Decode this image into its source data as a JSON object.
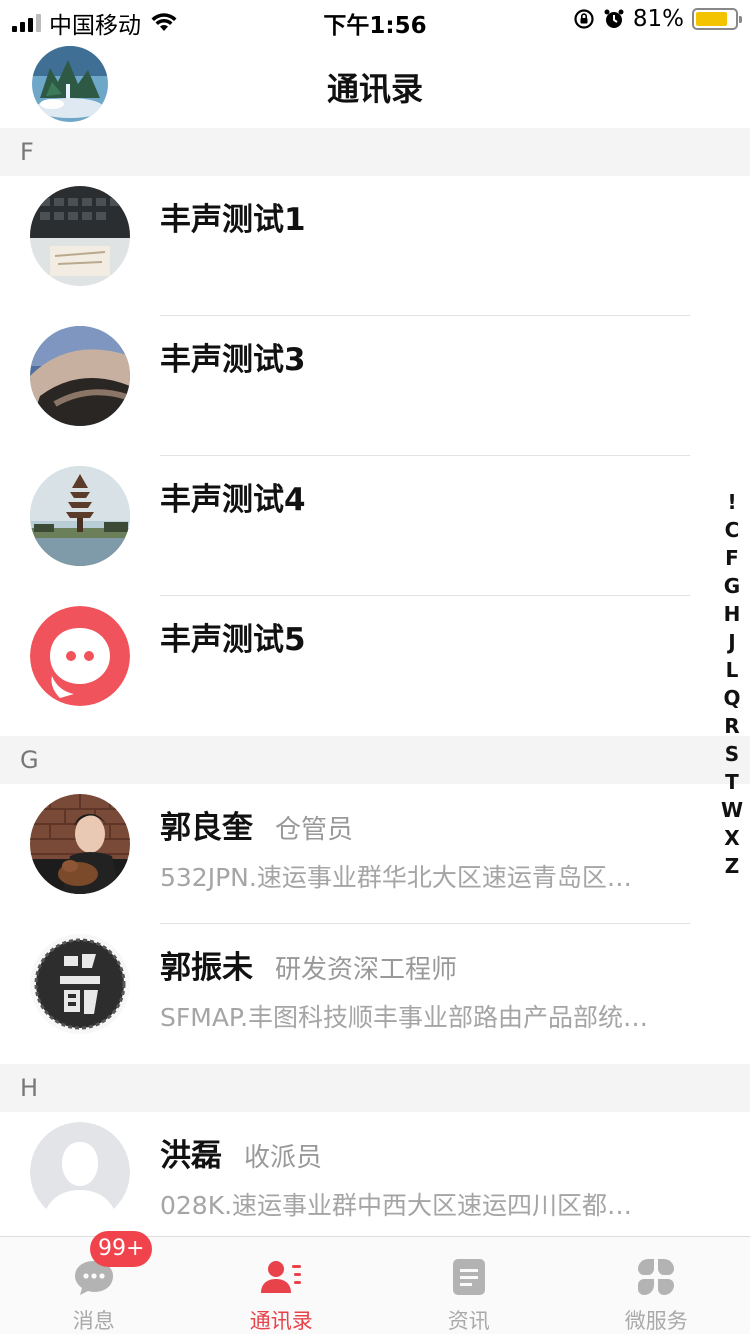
{
  "status_bar": {
    "carrier": "中国移动",
    "time": "下午1:56",
    "battery_percent": "81%",
    "battery_level": 0.81
  },
  "header": {
    "title": "通讯录"
  },
  "sections": [
    {
      "letter": "F",
      "contacts": [
        {
          "name": "丰声测试1"
        },
        {
          "name": "丰声测试3"
        },
        {
          "name": "丰声测试4"
        },
        {
          "name": "丰声测试5"
        }
      ]
    },
    {
      "letter": "G",
      "contacts": [
        {
          "name": "郭良奎",
          "role": "仓管员",
          "dept": "532JPN.速运事业群华北大区速运青岛区…"
        },
        {
          "name": "郭振未",
          "role": "研发资深工程师",
          "dept": "SFMAP.丰图科技顺丰事业部路由产品部统…"
        }
      ]
    },
    {
      "letter": "H",
      "contacts": [
        {
          "name": "洪磊",
          "role": "收派员",
          "dept": "028K.速运事业群中西大区速运四川区都…"
        }
      ]
    }
  ],
  "index_letters": [
    "!",
    "C",
    "F",
    "G",
    "H",
    "J",
    "L",
    "Q",
    "R",
    "S",
    "T",
    "W",
    "X",
    "Z"
  ],
  "tabbar": {
    "tabs": [
      {
        "label": "消息",
        "badge": "99+"
      },
      {
        "label": "通讯录"
      },
      {
        "label": "资讯"
      },
      {
        "label": "微服务"
      }
    ],
    "active_color": "#e8424a",
    "inactive_color": "#aaaaaa"
  }
}
